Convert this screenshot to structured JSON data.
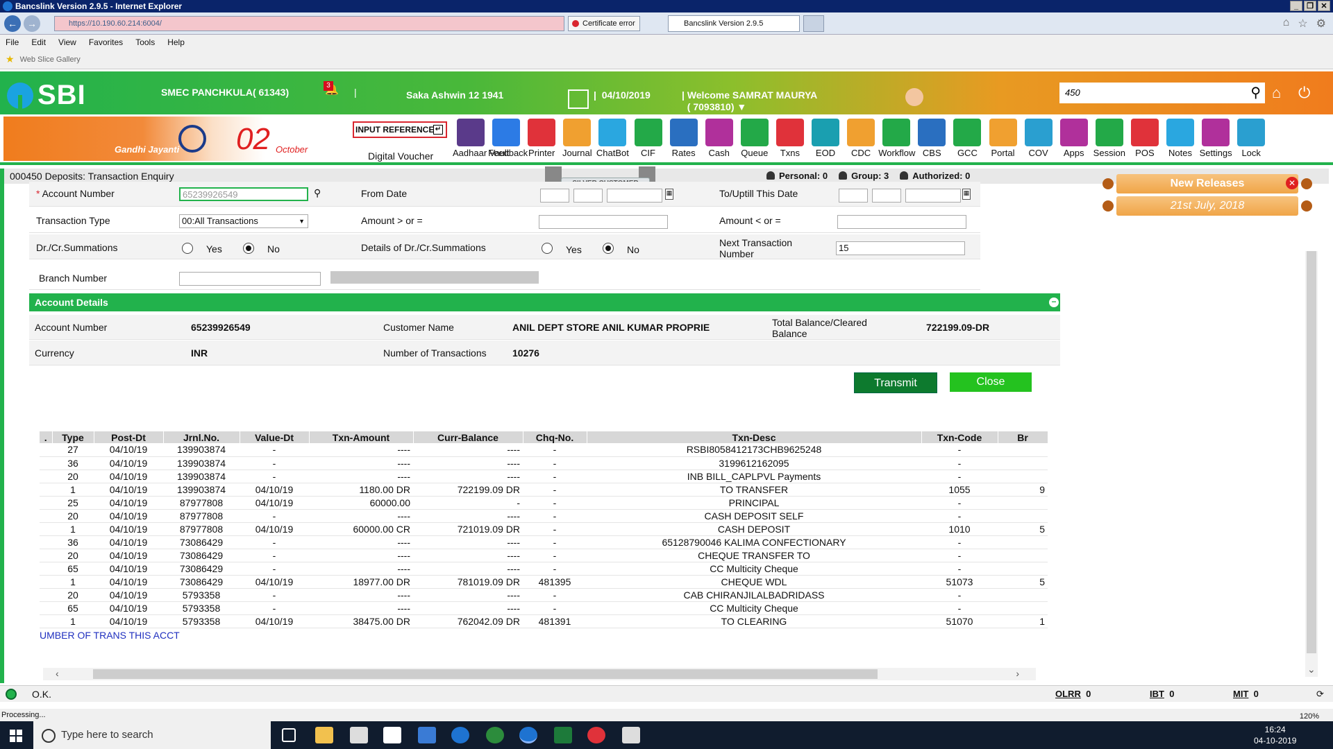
{
  "window": {
    "title": "Bancslink Version 2.9.5 - Internet Explorer",
    "url": "https://10.190.60.214:6004/",
    "cert_error": "Certificate error",
    "tab_title": "Bancslink Version 2.9.5"
  },
  "menu": [
    "File",
    "Edit",
    "View",
    "Favorites",
    "Tools",
    "Help"
  ],
  "favbar": {
    "item": "Web Slice Gallery"
  },
  "header": {
    "logo": "SBI",
    "branch": "SMEC PANCHKULA( 61343)",
    "notif_count": "3",
    "saka": "Saka Ashwin 12 1941",
    "date": "04/10/2019",
    "welcome_line1": "Welcome SAMRAT MAURYA",
    "welcome_line2": "( 7093810)",
    "search_value": "450"
  },
  "banner": {
    "gandhi": "Gandhi Jayanti",
    "oct_num": "02",
    "oct_word": "October",
    "input_ref": "INPUT REFERENCE",
    "digital_voucher": "Digital Voucher"
  },
  "tools": [
    {
      "label": "Aadhaar Vault",
      "color": "#5a3a8a"
    },
    {
      "label": "Feedback",
      "color": "#2c7be5"
    },
    {
      "label": "Printer",
      "color": "#e0323a"
    },
    {
      "label": "Journal",
      "color": "#f0a030"
    },
    {
      "label": "ChatBot",
      "color": "#2aa7e0"
    },
    {
      "label": "CIF",
      "color": "#23a948"
    },
    {
      "label": "Rates",
      "color": "#2a6fc0"
    },
    {
      "label": "Cash",
      "color": "#b0309b"
    },
    {
      "label": "Queue",
      "color": "#23a948"
    },
    {
      "label": "Txns",
      "color": "#e0323a"
    },
    {
      "label": "EOD",
      "color": "#1a9fb0"
    },
    {
      "label": "CDC",
      "color": "#f0a030"
    },
    {
      "label": "Workflow",
      "color": "#23a948"
    },
    {
      "label": "CBS",
      "color": "#2a6fc0"
    },
    {
      "label": "GCC",
      "color": "#23a948"
    },
    {
      "label": "Portal",
      "color": "#f0a030"
    },
    {
      "label": "COV",
      "color": "#2a9fd0"
    },
    {
      "label": "Apps",
      "color": "#b0309b"
    },
    {
      "label": "Session",
      "color": "#23a948"
    },
    {
      "label": "POS",
      "color": "#e0323a"
    },
    {
      "label": "Notes",
      "color": "#2aa7e0"
    },
    {
      "label": "Settings",
      "color": "#b0309b"
    },
    {
      "label": "Lock",
      "color": "#2a9fd0"
    }
  ],
  "txnbar": {
    "title": "000450 Deposits: Transaction Enquiry",
    "silver": "SILVER CUSTOMER",
    "personal": "Personal: 0",
    "group": "Group: 3",
    "authorized": "Authorized: 0"
  },
  "form": {
    "account_number_label": "Account Number",
    "required_mark": "*",
    "account_number_value": "65239926549",
    "from_date_label": "From Date",
    "to_date_label": "To/Uptill This Date",
    "txn_type_label": "Transaction Type",
    "txn_type_value": "00:All Transactions",
    "amount_gt_label": "Amount > or =",
    "amount_lt_label": "Amount < or =",
    "drcr_label": "Dr./Cr.Summations",
    "details_drcr_label": "Details of Dr./Cr.Summations",
    "yes": "Yes",
    "no": "No",
    "next_txn_label": "Next Transaction Number",
    "next_txn_value": "15",
    "branch_label": "Branch Number"
  },
  "account_details": {
    "heading": "Account Details",
    "acct_label": "Account Number",
    "acct_value": "65239926549",
    "cust_label": "Customer Name",
    "cust_value": "ANIL DEPT STORE ANIL KUMAR PROPRIE",
    "bal_label": "Total Balance/Cleared Balance",
    "bal_value": "722199.09-DR",
    "cur_label": "Currency",
    "cur_value": "INR",
    "ntx_label": "Number of Transactions",
    "ntx_value": "10276"
  },
  "buttons": {
    "transmit": "Transmit",
    "close": "Close"
  },
  "new_releases": {
    "title": "New Releases",
    "date": "21st July, 2018"
  },
  "table": {
    "headers": [
      ".",
      "Type",
      "Post-Dt",
      "Jrnl.No.",
      "Value-Dt",
      "Txn-Amount",
      "Curr-Balance",
      "Chq-No.",
      "Txn-Desc",
      "Txn-Code",
      "Br"
    ],
    "rows": [
      [
        "",
        "27",
        "04/10/19",
        "139903874",
        "-",
        "----",
        "----",
        "-",
        "RSBI8058412173CHB9625248",
        "-",
        ""
      ],
      [
        "",
        "36",
        "04/10/19",
        "139903874",
        "-",
        "----",
        "----",
        "-",
        "3199612162095",
        "-",
        ""
      ],
      [
        "",
        "20",
        "04/10/19",
        "139903874",
        "-",
        "----",
        "----",
        "-",
        "INB BILL_CAPLPVL Payments",
        "-",
        ""
      ],
      [
        "",
        "1",
        "04/10/19",
        "139903874",
        "04/10/19",
        "1180.00 DR",
        "722199.09 DR",
        "-",
        "TO TRANSFER",
        "1055",
        "9"
      ],
      [
        "",
        "25",
        "04/10/19",
        "87977808",
        "04/10/19",
        "60000.00",
        "-",
        "-",
        "PRINCIPAL",
        "-",
        ""
      ],
      [
        "",
        "20",
        "04/10/19",
        "87977808",
        "-",
        "----",
        "----",
        "-",
        "CASH DEPOSIT SELF",
        "-",
        ""
      ],
      [
        "",
        "1",
        "04/10/19",
        "87977808",
        "04/10/19",
        "60000.00 CR",
        "721019.09 DR",
        "-",
        "CASH DEPOSIT",
        "1010",
        "5"
      ],
      [
        "",
        "36",
        "04/10/19",
        "73086429",
        "-",
        "----",
        "----",
        "-",
        "65128790046 KALIMA CONFECTIONARY",
        "-",
        ""
      ],
      [
        "",
        "20",
        "04/10/19",
        "73086429",
        "-",
        "----",
        "----",
        "-",
        "CHEQUE TRANSFER TO",
        "-",
        ""
      ],
      [
        "",
        "65",
        "04/10/19",
        "73086429",
        "-",
        "----",
        "----",
        "-",
        "CC Multicity Cheque",
        "-",
        ""
      ],
      [
        "",
        "1",
        "04/10/19",
        "73086429",
        "04/10/19",
        "18977.00 DR",
        "781019.09 DR",
        "481395",
        "CHEQUE WDL",
        "51073",
        "5"
      ],
      [
        "",
        "20",
        "04/10/19",
        "5793358",
        "-",
        "----",
        "----",
        "-",
        "CAB CHIRANJILALBADRIDASS",
        "-",
        ""
      ],
      [
        "",
        "65",
        "04/10/19",
        "5793358",
        "-",
        "----",
        "----",
        "-",
        "CC Multicity Cheque",
        "-",
        ""
      ],
      [
        "",
        "1",
        "04/10/19",
        "5793358",
        "04/10/19",
        "38475.00 DR",
        "762042.09 DR",
        "481391",
        "TO CLEARING",
        "51070",
        "1"
      ]
    ],
    "footer": "UMBER OF TRANS THIS ACCT"
  },
  "status": {
    "ok": "O.K.",
    "olrr": "OLRR",
    "olrr_v": "0",
    "ibt": "IBT",
    "ibt_v": "0",
    "mit": "MIT",
    "mit_v": "0",
    "processing": "Processing...",
    "zoom": "120%"
  },
  "taskbar": {
    "search": "Type here to search",
    "time": "16:24",
    "date": "04-10-2019"
  }
}
